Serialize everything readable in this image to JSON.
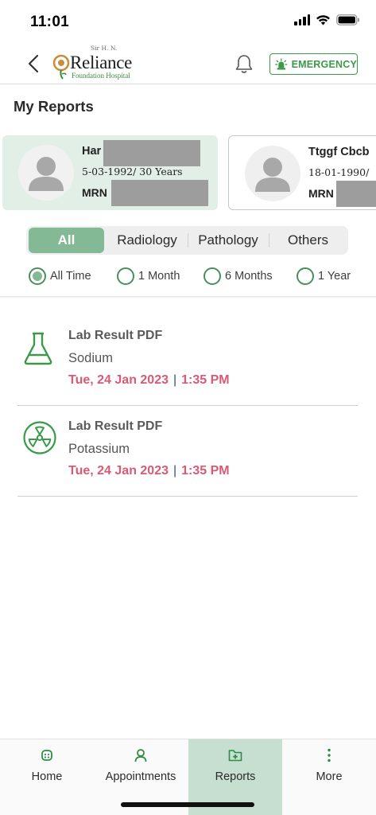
{
  "status_bar": {
    "time": "11:01"
  },
  "header": {
    "logo_top": "Sir H. N.",
    "logo_main": "Reliance",
    "logo_sub": "Foundation Hospital",
    "emergency_label": "EMERGENCY"
  },
  "page_title": "My Reports",
  "patients": [
    {
      "name": "Har",
      "dob": "5-03-1992/  30 Years",
      "mrn_label": "MRN",
      "selected": true
    },
    {
      "name": "Ttggf Cbcb",
      "dob": "18-01-1990/",
      "mrn_label": "MRN",
      "selected": false
    }
  ],
  "category_tabs": [
    {
      "label": "All",
      "active": true
    },
    {
      "label": "Radiology",
      "active": false
    },
    {
      "label": "Pathology",
      "active": false
    },
    {
      "label": "Others",
      "active": false
    }
  ],
  "time_filters": [
    {
      "label": "All Time",
      "selected": true
    },
    {
      "label": "1 Month",
      "selected": false
    },
    {
      "label": "6 Months",
      "selected": false
    },
    {
      "label": "1 Year",
      "selected": false
    }
  ],
  "reports": [
    {
      "icon": "flask-icon",
      "title": "Lab Result PDF",
      "test": "Sodium",
      "date": "Tue, 24 Jan 2023",
      "separator": "|",
      "time": "1:35 PM"
    },
    {
      "icon": "radiation-icon",
      "title": "Lab Result PDF",
      "test": "Potassium",
      "date": "Tue, 24 Jan 2023",
      "separator": "|",
      "time": "1:35 PM"
    }
  ],
  "bottom_nav": [
    {
      "label": "Home",
      "icon": "home-icon",
      "active": false
    },
    {
      "label": "Appointments",
      "icon": "person-icon",
      "active": false
    },
    {
      "label": "Reports",
      "icon": "reports-folder-icon",
      "active": true
    },
    {
      "label": "More",
      "icon": "more-dots-icon",
      "active": false
    }
  ],
  "colors": {
    "accent_green": "#3a9a4a",
    "active_tab": "#84b996",
    "selected_card": "#e1efe6",
    "date_pink": "#d85a74",
    "nav_active": "#c7dfd1"
  }
}
